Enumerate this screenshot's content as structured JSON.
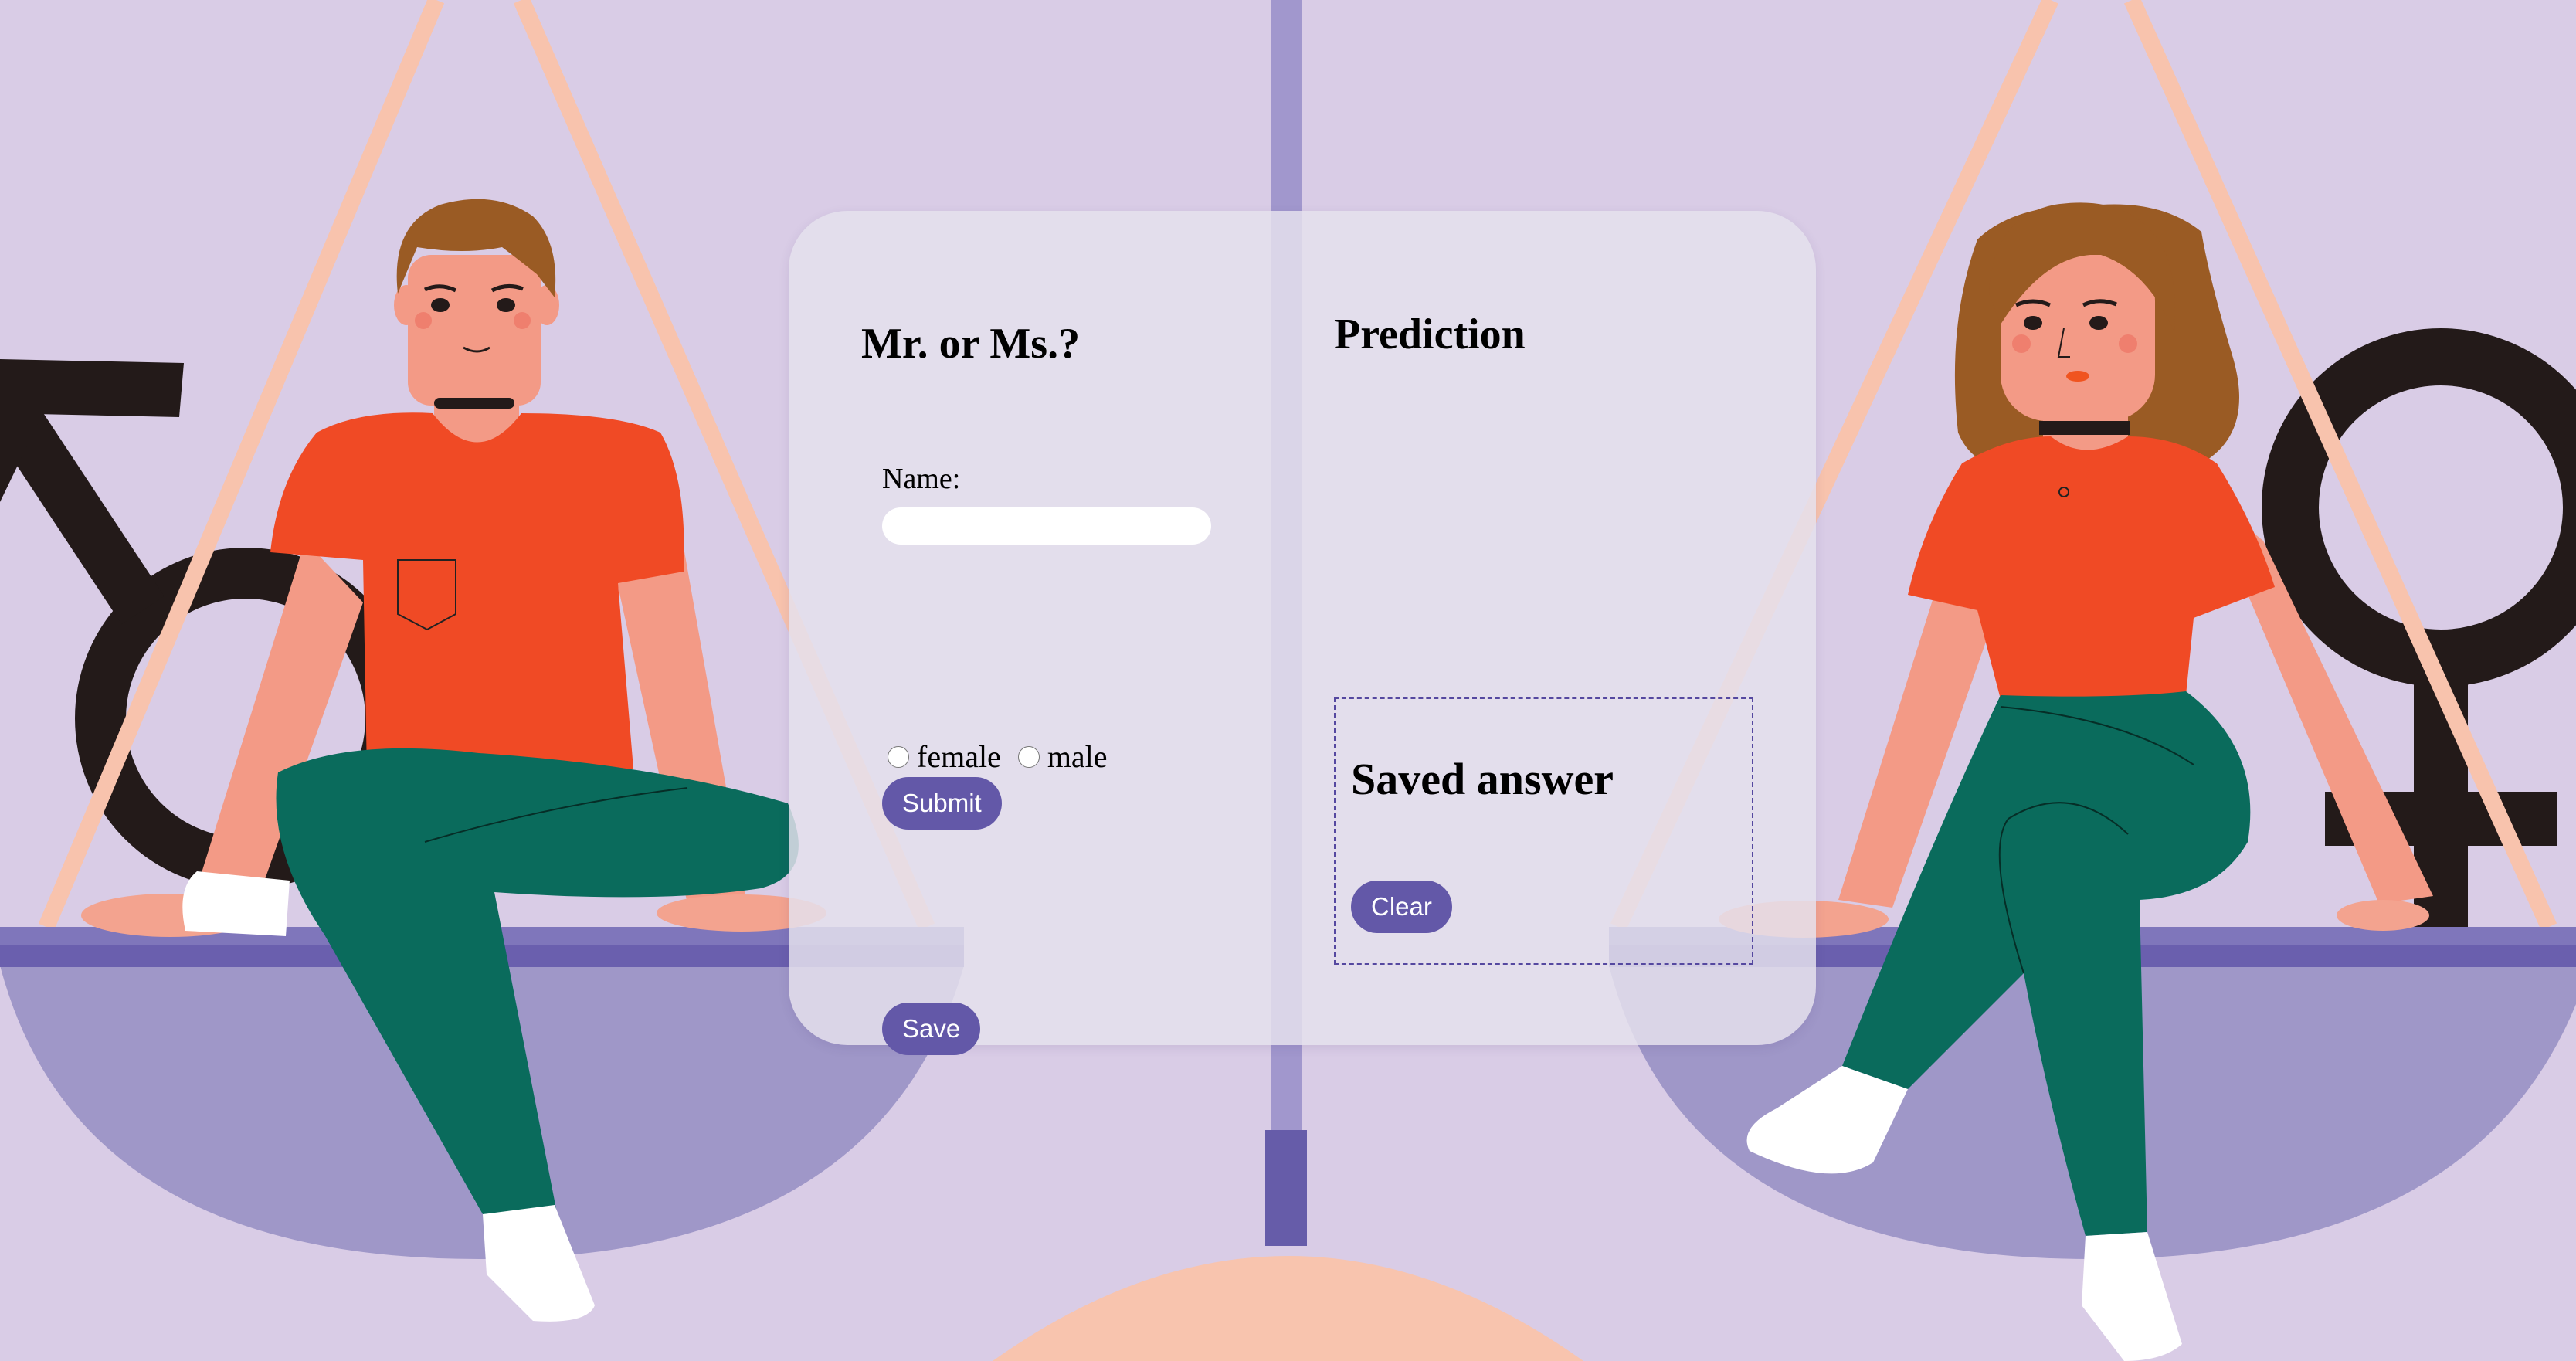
{
  "left_panel": {
    "title": "Mr. or Ms.?",
    "name_label": "Name:",
    "name_input_value": "",
    "submit_label": "Submit",
    "radio_options": [
      "female",
      "male"
    ],
    "save_label": "Save"
  },
  "right_panel": {
    "title": "Prediction",
    "saved_title": "Saved answer",
    "clear_label": "Clear"
  },
  "colors": {
    "background": "#d9cce6",
    "accent_button": "#6358a8",
    "scale_pan": "#9f97c8",
    "scale_beam": "#6a5fae",
    "shirt": "#f04a25",
    "pants": "#0a6b5c",
    "skin": "#f39a86",
    "hair": "#9a5b24",
    "gender_symbol": "#231a19",
    "rope": "#f8c3ad"
  },
  "icons": [
    "male-symbol-icon",
    "female-symbol-icon"
  ]
}
